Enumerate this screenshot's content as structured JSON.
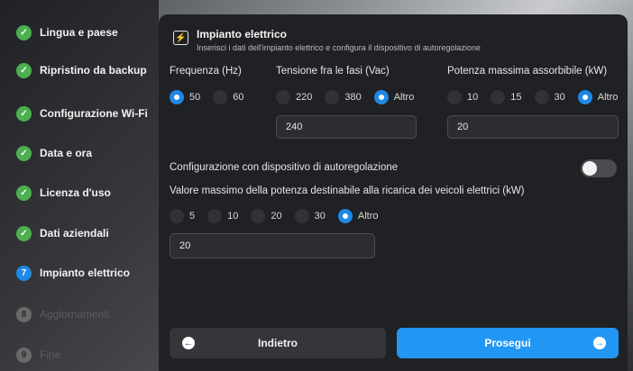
{
  "sidebar": {
    "steps": [
      {
        "label": "Lingua e paese",
        "marker": "✓",
        "state": "done"
      },
      {
        "label": "Ripristino da backup",
        "marker": "✓",
        "state": "done"
      },
      {
        "label": "Configurazione Wi-Fi",
        "marker": "✓",
        "state": "done"
      },
      {
        "label": "Data e ora",
        "marker": "✓",
        "state": "done"
      },
      {
        "label": "Licenza d'uso",
        "marker": "✓",
        "state": "done"
      },
      {
        "label": "Dati aziendali",
        "marker": "✓",
        "state": "done"
      },
      {
        "label": "Impianto elettrico",
        "marker": "7",
        "state": "current"
      },
      {
        "label": "Aggiornamenti",
        "marker": "8",
        "state": "pending"
      },
      {
        "label": "Fine",
        "marker": "9",
        "state": "pending"
      }
    ]
  },
  "header": {
    "icon": "power-plug-icon",
    "title": "Impianto elettrico",
    "subtitle": "Inserisci i dati dell'impianto elettrico e configura il dispositivo di autoregolazione"
  },
  "frequency": {
    "label": "Frequenza (Hz)",
    "options": [
      "50",
      "60"
    ],
    "selected": "50"
  },
  "voltage": {
    "label": "Tensione fra le fasi (Vac)",
    "options": [
      "220",
      "380",
      "Altro"
    ],
    "selected": "Altro",
    "custom_value": "240"
  },
  "max_power": {
    "label": "Potenza massima assorbibile (kW)",
    "options": [
      "10",
      "15",
      "30",
      "Altro"
    ],
    "selected": "Altro",
    "custom_value": "20"
  },
  "autoregulation": {
    "label": "Configurazione con dispositivo di autoregolazione",
    "enabled": false
  },
  "ev_power": {
    "label": "Valore massimo della potenza destinabile alla ricarica dei veicoli elettrici (kW)",
    "options": [
      "5",
      "10",
      "20",
      "30",
      "Altro"
    ],
    "selected": "Altro",
    "custom_value": "20"
  },
  "buttons": {
    "back_label": "Indietro",
    "back_icon": "arrow-left-circle-icon",
    "next_label": "Prosegui",
    "next_icon": "arrow-right-circle-icon"
  },
  "colors": {
    "accent": "#2196f3",
    "done": "#4caf50",
    "panel": "#202124"
  }
}
